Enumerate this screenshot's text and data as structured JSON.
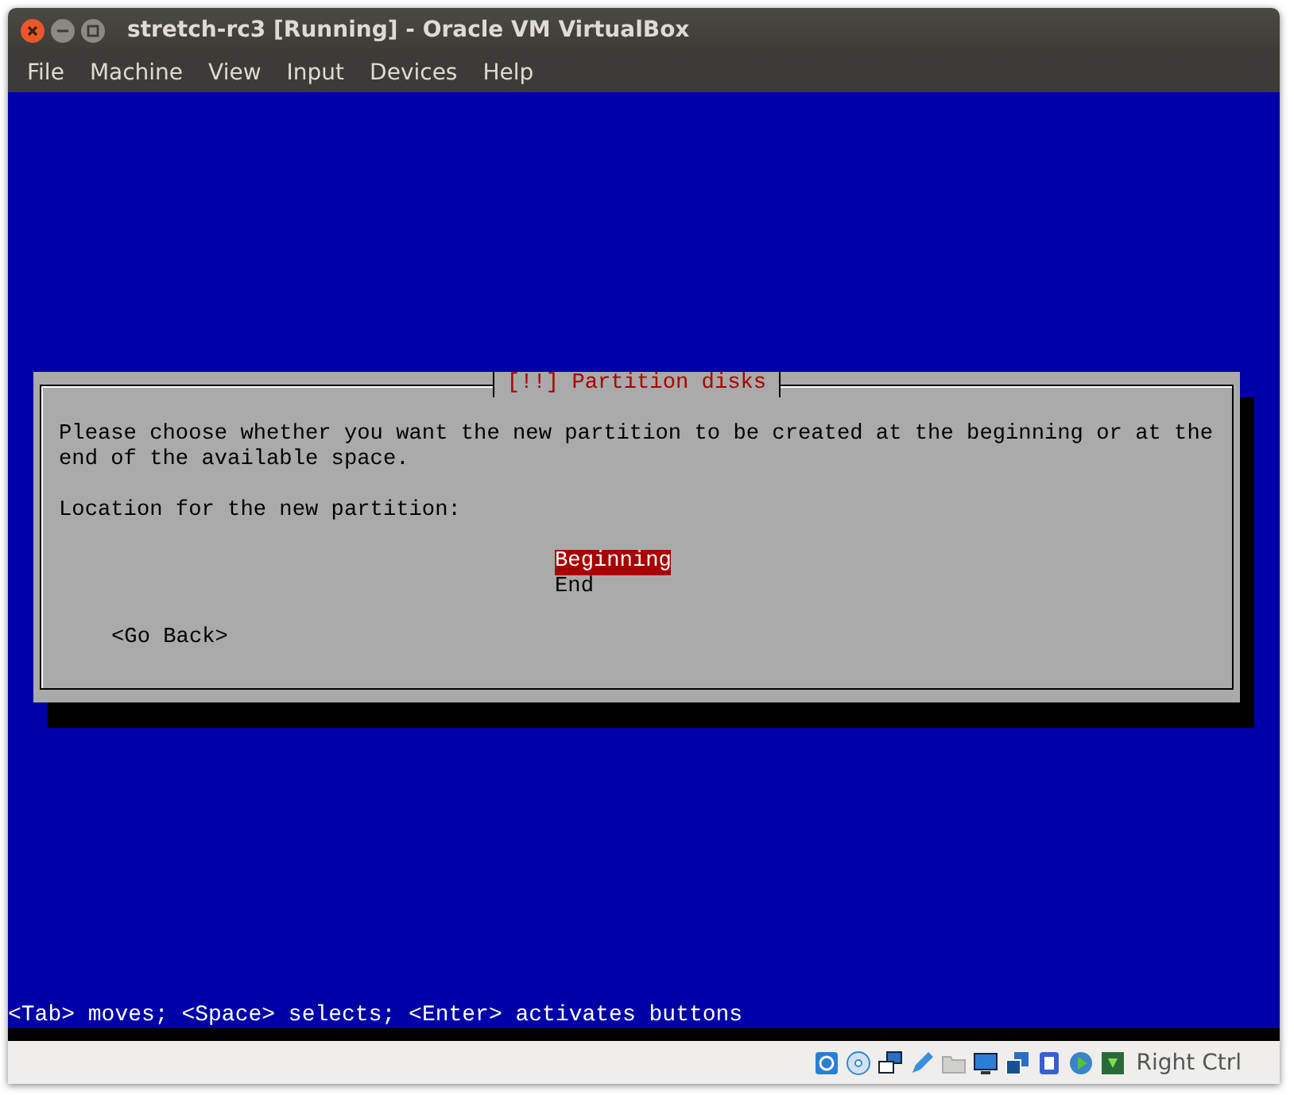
{
  "window": {
    "title": "stretch-rc3 [Running] - Oracle VM VirtualBox"
  },
  "menu": [
    "File",
    "Machine",
    "View",
    "Input",
    "Devices",
    "Help"
  ],
  "dialog": {
    "title": "[!!] Partition disks",
    "message": "Please choose whether you want the new partition to be created at the beginning or at the end of the available space.",
    "prompt": "Location for the new partition:",
    "options": [
      {
        "label": "Beginning",
        "selected": true
      },
      {
        "label": "End",
        "selected": false
      }
    ],
    "back_button": "<Go Back>"
  },
  "help_line": "<Tab> moves; <Space> selects; <Enter> activates buttons",
  "status_bar": {
    "host_key": "Right Ctrl"
  }
}
